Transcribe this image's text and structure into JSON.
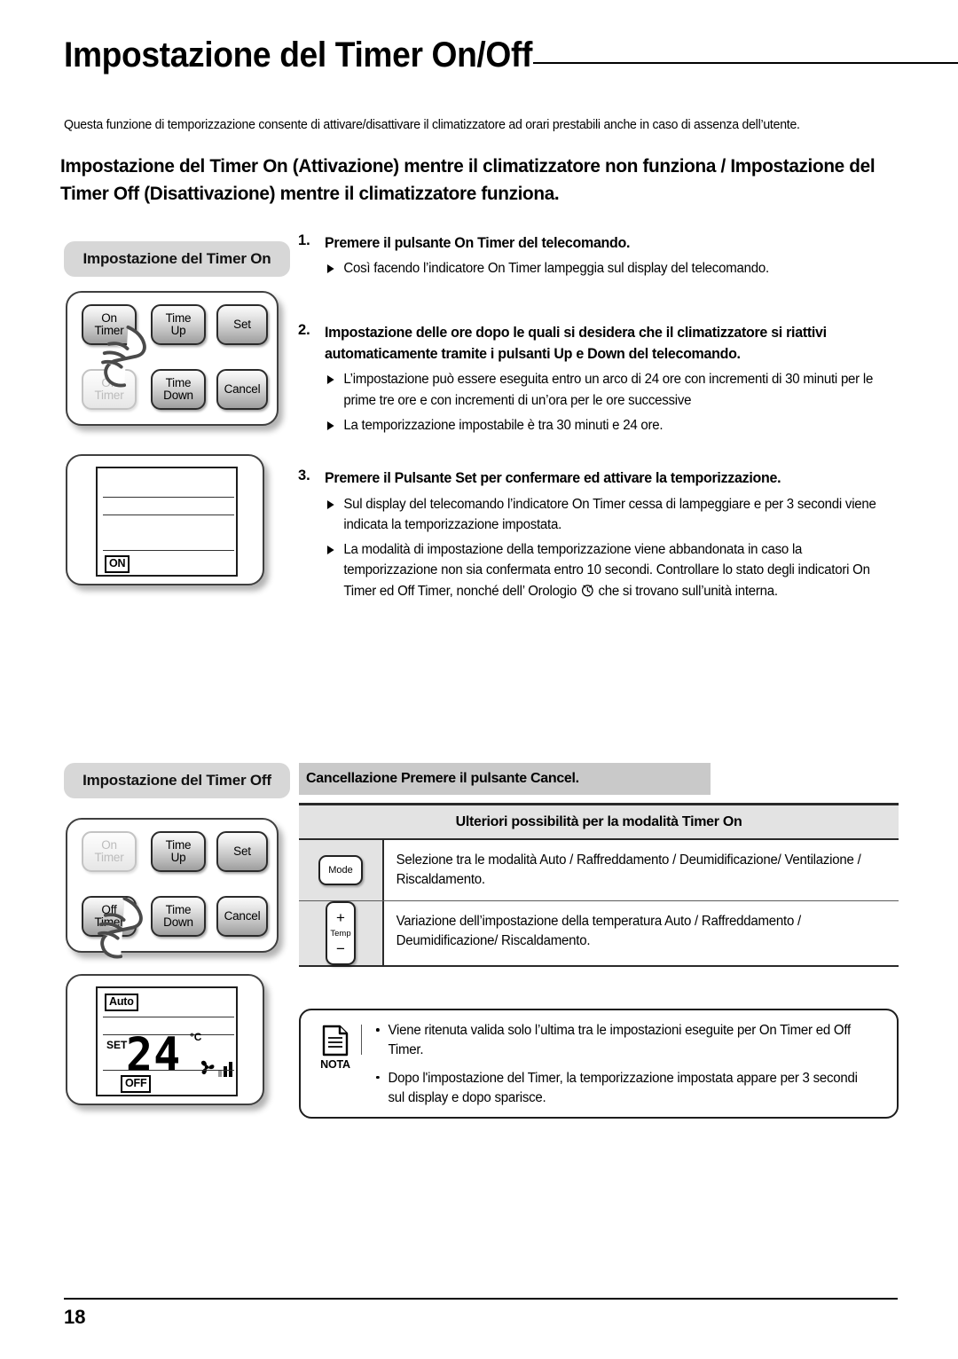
{
  "document": {
    "title": "Impostazione del Timer On/Off",
    "intro": "Questa funzione di temporizzazione consente di attivare/disattivare il climatizzatore ad orari prestabili anche in caso di assenza dell’utente.",
    "section_heading": "Impostazione del Timer On (Attivazione) mentre il climatizzatore non funziona / Impostazione del Timer Off (Disattivazione) mentre il climatizzatore  funziona.",
    "page_number": "18"
  },
  "timer_on_panel": {
    "pill_label": "Impostazione del Timer On",
    "keypad": {
      "on_timer_line1": "On",
      "on_timer_line2": "Timer",
      "time_up_line1": "Time",
      "time_up_line2": "Up",
      "set": "Set",
      "off_timer_line1": "Off",
      "off_timer_line2": "Timer",
      "time_down_line1": "Time",
      "time_down_line2": "Down",
      "cancel": "Cancel"
    },
    "lcd": {
      "on_badge": "ON"
    }
  },
  "timer_off_panel": {
    "pill_label": "Impostazione del Timer Off",
    "keypad": {
      "on_timer_line1": "On",
      "on_timer_line2": "Timer",
      "time_up_line1": "Time",
      "time_up_line2": "Up",
      "set": "Set",
      "off_timer_line1": "Off",
      "off_timer_line2": "Timer",
      "time_down_line1": "Time",
      "time_down_line2": "Down",
      "cancel": "Cancel"
    },
    "lcd": {
      "mode_badge": "Auto",
      "set_label": "SET",
      "temperature": "24",
      "unit": "°C",
      "off_badge": "OFF"
    }
  },
  "steps": [
    {
      "number": "1.",
      "title": "Premere il pulsante On Timer del telecomando.",
      "bullets": [
        "Così facendo l’indicatore On Timer  lampeggia sul display del telecomando."
      ]
    },
    {
      "number": "2.",
      "title": "Impostazione delle ore dopo le quali  si desidera che il climatizzatore si riattivi automaticamente tramite i pulsanti Up e Down del telecomando.",
      "bullets": [
        "L’impostazione può essere eseguita entro un arco di 24 ore con incrementi di 30 minuti per le prime tre ore e con incrementi di un’ora per le ore successive",
        "La temporizzazione impostabile è tra 30 minuti e 24 ore."
      ]
    },
    {
      "number": "3.",
      "title": "Premere il Pulsante Set per confermare ed attivare  la temporizzazione.",
      "bullets": [
        "Sul display del telecomando l’indicatore On Timer cessa di lampeggiare e per 3 secondi viene indicata la temporizzazione impostata."
      ],
      "bullet_with_clock_part1": "La modalità di impostazione della temporizzazione viene abbandonata in caso la temporizzazione non sia confermata entro 10 secondi.  Controllare lo stato degli indicatori On Timer ed Off Timer, nonché dell’ Orologio ",
      "bullet_with_clock_part2": " che si trovano sull’unità interna."
    }
  ],
  "cancellation_band": "Cancellazione  Premere il pulsante Cancel.",
  "options_table": {
    "header": "Ulteriori possibilità  per la modalità Timer On",
    "rows": [
      {
        "button_label": "Mode",
        "text": "Selezione tra le modalità Auto / Raffreddamento / Deumidificazione/ Ventilazione  / Riscaldamento."
      },
      {
        "button_plus": "+",
        "button_label": "Temp",
        "button_minus": "−",
        "text": "Variazione dell’impostazione della temperatura Auto / Raffreddamento / Deumidificazione/ Riscaldamento."
      }
    ]
  },
  "nota": {
    "label": "NOTA",
    "items": [
      "Viene ritenuta valida solo  l’ultima tra le impostazioni eseguite per  On Timer ed Off Timer.",
      "Dopo l'impostazione del Timer, la temporizzazione impostata appare per 3 secondi sul display e dopo sparisce."
    ]
  },
  "colors": {
    "pill_gray": "#d7d7d7",
    "band_gray": "#c9c9c9",
    "table_head_gray": "#e3e3e3",
    "button_border": "#2b2b2b",
    "disabled_text": "#bcbcbc"
  }
}
